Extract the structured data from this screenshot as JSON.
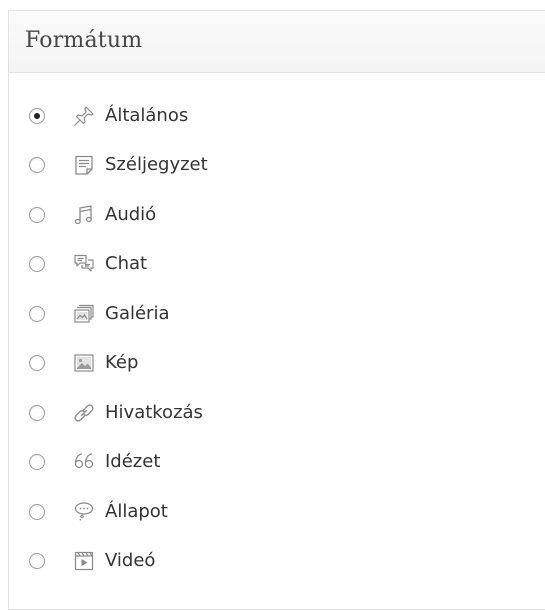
{
  "panel": {
    "title": "Formátum"
  },
  "formats": [
    {
      "label": "Általános",
      "icon": "pushpin-icon",
      "checked": true
    },
    {
      "label": "Széljegyzet",
      "icon": "aside-note-icon",
      "checked": false
    },
    {
      "label": "Audió",
      "icon": "audio-note-icon",
      "checked": false
    },
    {
      "label": "Chat",
      "icon": "chat-bubbles-icon",
      "checked": false
    },
    {
      "label": "Galéria",
      "icon": "gallery-icon",
      "checked": false
    },
    {
      "label": "Kép",
      "icon": "image-icon",
      "checked": false
    },
    {
      "label": "Hivatkozás",
      "icon": "link-icon",
      "checked": false
    },
    {
      "label": "Idézet",
      "icon": "quote-icon",
      "checked": false
    },
    {
      "label": "Állapot",
      "icon": "status-bubble-icon",
      "checked": false
    },
    {
      "label": "Videó",
      "icon": "video-icon",
      "checked": false
    }
  ],
  "colors": {
    "icon_stroke": "#8a8a8a",
    "text": "#333333",
    "header_bg": "#f8f8f8"
  }
}
